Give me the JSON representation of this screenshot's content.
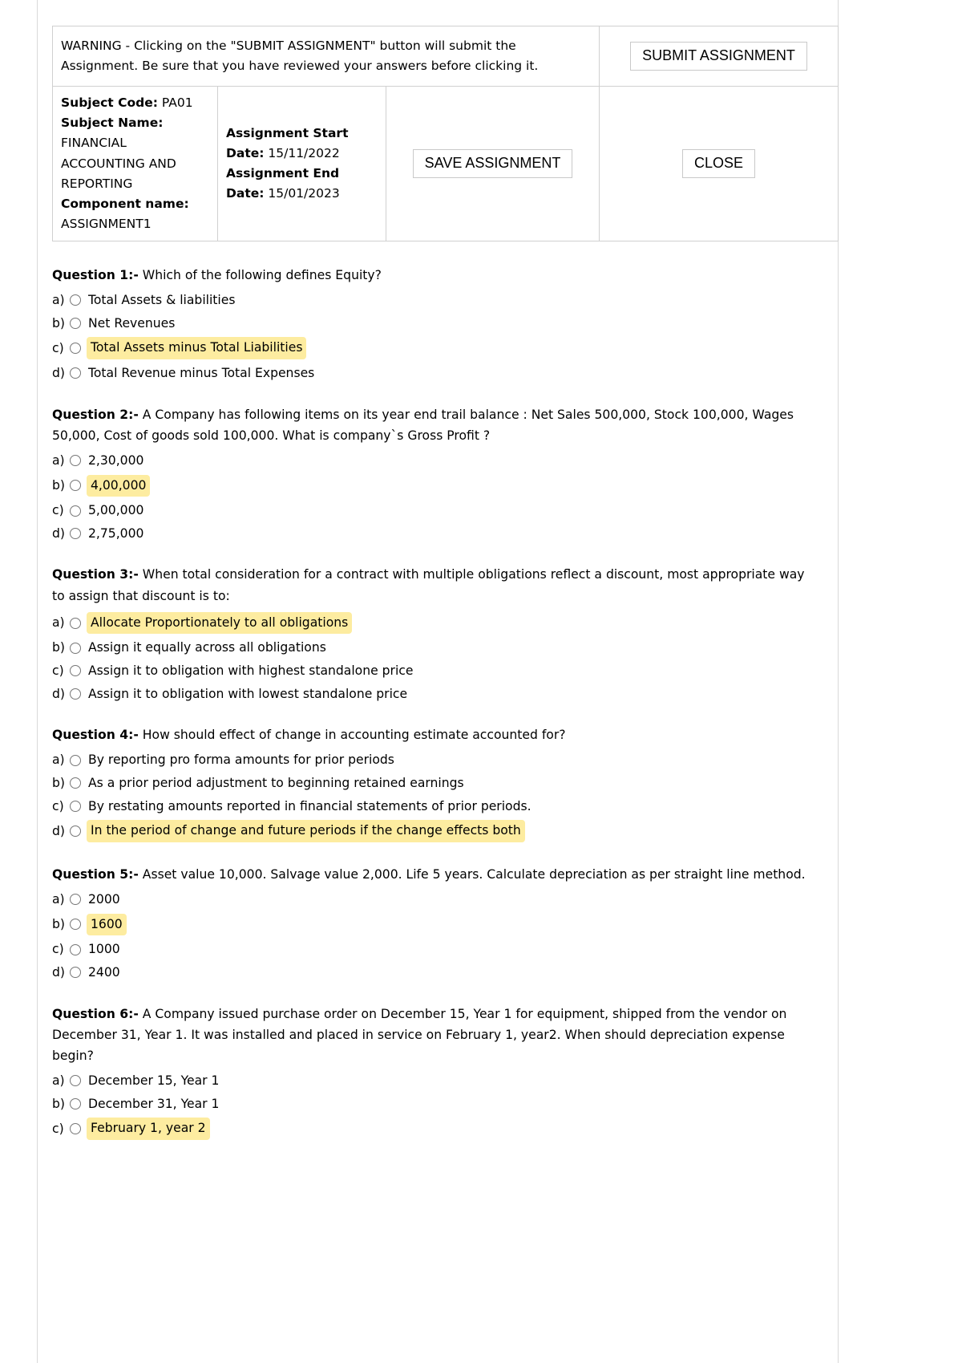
{
  "header": {
    "warning_text": "WARNING - Clicking on the \"SUBMIT ASSIGNMENT\" button will submit the Assignment. Be sure that you have reviewed your answers before clicking it.",
    "submit_button": "SUBMIT ASSIGNMENT",
    "save_button": "SAVE ASSIGNMENT",
    "close_button": "CLOSE",
    "subject_code_label": "Subject Code:",
    "subject_code_value": "PA01",
    "subject_name_label": "Subject Name:",
    "subject_name_value": "FINANCIAL ACCOUNTING AND REPORTING",
    "component_label": "Component name:",
    "component_value": "ASSIGNMENT1",
    "start_date_label": "Assignment Start Date:",
    "start_date_value": "15/11/2022",
    "end_date_label": "Assignment End Date:",
    "end_date_value": "15/01/2023"
  },
  "highlight_color": "#fdeca0",
  "questions": [
    {
      "number": "Question 1:-",
      "text": "Which of the following defines Equity?",
      "options": [
        {
          "letter": "a)",
          "text": "Total Assets & liabilities",
          "highlighted": false
        },
        {
          "letter": "b)",
          "text": "Net Revenues",
          "highlighted": false
        },
        {
          "letter": "c)",
          "text": "Total Assets minus Total Liabilities",
          "highlighted": true
        },
        {
          "letter": "d)",
          "text": "Total Revenue minus Total Expenses",
          "highlighted": false
        }
      ]
    },
    {
      "number": "Question 2:-",
      "text": "A Company has following items on its year end trail balance : Net Sales 500,000, Stock 100,000, Wages 50,000, Cost of goods sold 100,000. What is company`s Gross Profit ?",
      "options": [
        {
          "letter": "a)",
          "text": "2,30,000",
          "highlighted": false
        },
        {
          "letter": "b)",
          "text": "4,00,000",
          "highlighted": true
        },
        {
          "letter": "c)",
          "text": "5,00,000",
          "highlighted": false
        },
        {
          "letter": "d)",
          "text": "2,75,000",
          "highlighted": false
        }
      ]
    },
    {
      "number": "Question 3:-",
      "text": "When total consideration for a contract with multiple obligations reflect a discount, most appropriate way to assign that discount is to:",
      "options": [
        {
          "letter": "a)",
          "text": "Allocate Proportionately to all obligations",
          "highlighted": true
        },
        {
          "letter": "b)",
          "text": "Assign it equally across all obligations",
          "highlighted": false
        },
        {
          "letter": "c)",
          "text": "Assign it to obligation with highest standalone price",
          "highlighted": false
        },
        {
          "letter": "d)",
          "text": "Assign it to obligation with lowest standalone price",
          "highlighted": false
        }
      ]
    },
    {
      "number": "Question 4:-",
      "text": "How should effect of change in accounting estimate accounted for?",
      "options": [
        {
          "letter": "a)",
          "text": "By reporting pro forma amounts for prior periods",
          "highlighted": false
        },
        {
          "letter": "b)",
          "text": "As a prior period adjustment to beginning retained earnings",
          "highlighted": false
        },
        {
          "letter": "c)",
          "text": "By restating amounts reported in financial statements of prior periods.",
          "highlighted": false
        },
        {
          "letter": "d)",
          "text": "In the period of change and future periods if the change effects both",
          "highlighted": true
        }
      ]
    },
    {
      "number": "Question 5:-",
      "text": "Asset value 10,000. Salvage value 2,000. Life 5 years. Calculate depreciation as per straight line method.",
      "options": [
        {
          "letter": "a)",
          "text": "2000",
          "highlighted": false
        },
        {
          "letter": "b)",
          "text": "1600",
          "highlighted": true
        },
        {
          "letter": "c)",
          "text": "1000",
          "highlighted": false
        },
        {
          "letter": "d)",
          "text": "2400",
          "highlighted": false
        }
      ]
    },
    {
      "number": "Question 6:-",
      "text": "A Company issued purchase order on December 15, Year 1 for equipment, shipped from the vendor on December 31, Year 1. It was installed and placed in service on February 1, year2. When should depreciation expense begin?",
      "options": [
        {
          "letter": "a)",
          "text": "December 15, Year 1",
          "highlighted": false
        },
        {
          "letter": "b)",
          "text": "December 31, Year 1",
          "highlighted": false
        },
        {
          "letter": "c)",
          "text": "February 1, year 2",
          "highlighted": true
        }
      ]
    }
  ]
}
